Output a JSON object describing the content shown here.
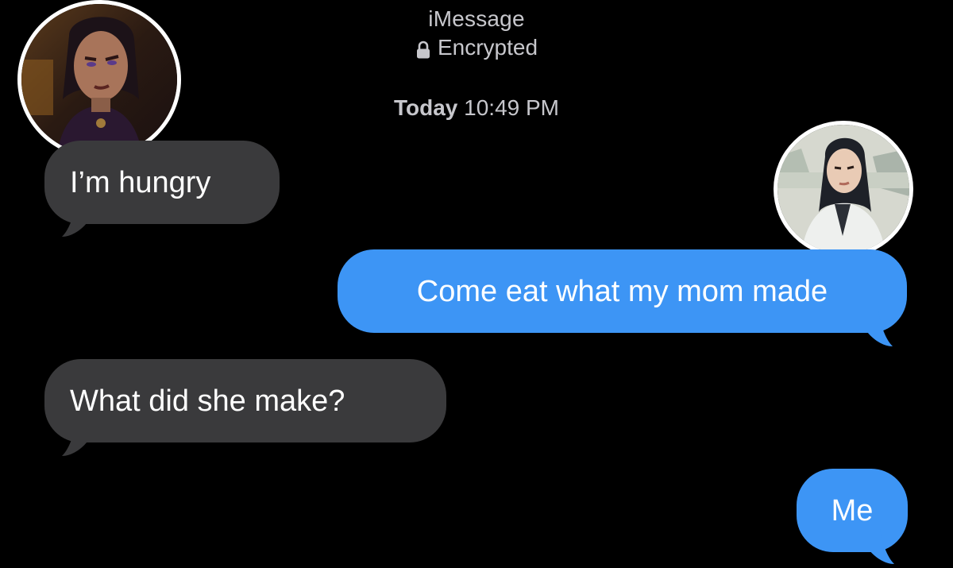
{
  "header": {
    "service": "iMessage",
    "encryption": "Encrypted",
    "lock_icon": "lock-icon"
  },
  "timestamp": {
    "day": "Today",
    "time": "10:49 PM"
  },
  "messages": [
    {
      "direction": "received",
      "text": "I’m hungry"
    },
    {
      "direction": "sent",
      "text": "Come eat what my mom made"
    },
    {
      "direction": "received",
      "text": "What did she make?"
    },
    {
      "direction": "sent",
      "text": "Me"
    }
  ],
  "colors": {
    "background": "#000000",
    "received_bubble": "#3a3a3c",
    "sent_bubble": "#3d95f5",
    "meta_text": "#c7c7cc"
  },
  "avatars": [
    {
      "name": "contact-avatar",
      "icon": "portrait-avatar"
    },
    {
      "name": "user-avatar",
      "icon": "portrait-avatar"
    }
  ]
}
